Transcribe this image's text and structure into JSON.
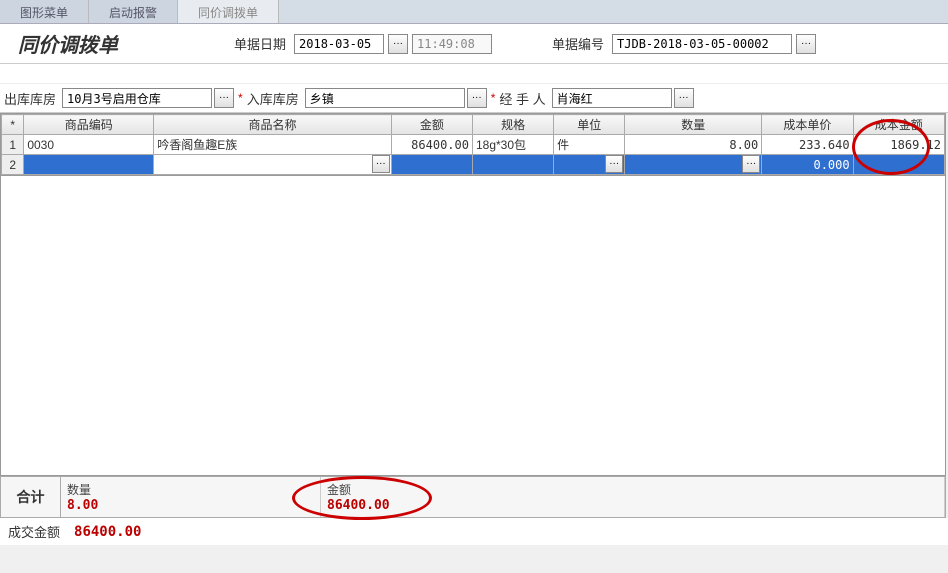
{
  "tabs": [
    {
      "label": "图形菜单"
    },
    {
      "label": "启动报警"
    },
    {
      "label": "同价调拨单"
    }
  ],
  "title": "同价调拨单",
  "header": {
    "date_label": "单据日期",
    "date_value": "2018-03-05",
    "time_value": "11:49:08",
    "docno_label": "单据编号",
    "docno_value": "TJDB-2018-03-05-00002"
  },
  "filters": {
    "out_wh_label": "出库库房",
    "out_wh_value": "10月3号启用仓库",
    "in_wh_label": "入库库房",
    "in_wh_value": "乡镇",
    "handler_label": "经 手 人",
    "handler_value": "肖海红"
  },
  "grid": {
    "headers": [
      "*",
      "商品编码",
      "商品名称",
      "金额",
      "规格",
      "单位",
      "数量",
      "成本单价",
      "成本金额"
    ],
    "rows": [
      {
        "n": "1",
        "code": "0030",
        "name": "吟香阁鱼趣E族",
        "amount": "86400.00",
        "spec": "18g*30包",
        "unit": "件",
        "qty": "8.00",
        "cost_price": "233.640",
        "cost_amt": "1869.12"
      },
      {
        "n": "2",
        "code": "",
        "name": "",
        "amount": "",
        "spec": "",
        "unit": "",
        "qty": "",
        "cost_price": "0.000",
        "cost_amt": ""
      }
    ]
  },
  "totals": {
    "label": "合计",
    "qty_label": "数量",
    "qty_value": "8.00",
    "amt_label": "金额",
    "amt_value": "86400.00"
  },
  "footer": {
    "deal_amt_label": "成交金额",
    "deal_amt_value": "86400.00"
  },
  "ellipsis": "···"
}
